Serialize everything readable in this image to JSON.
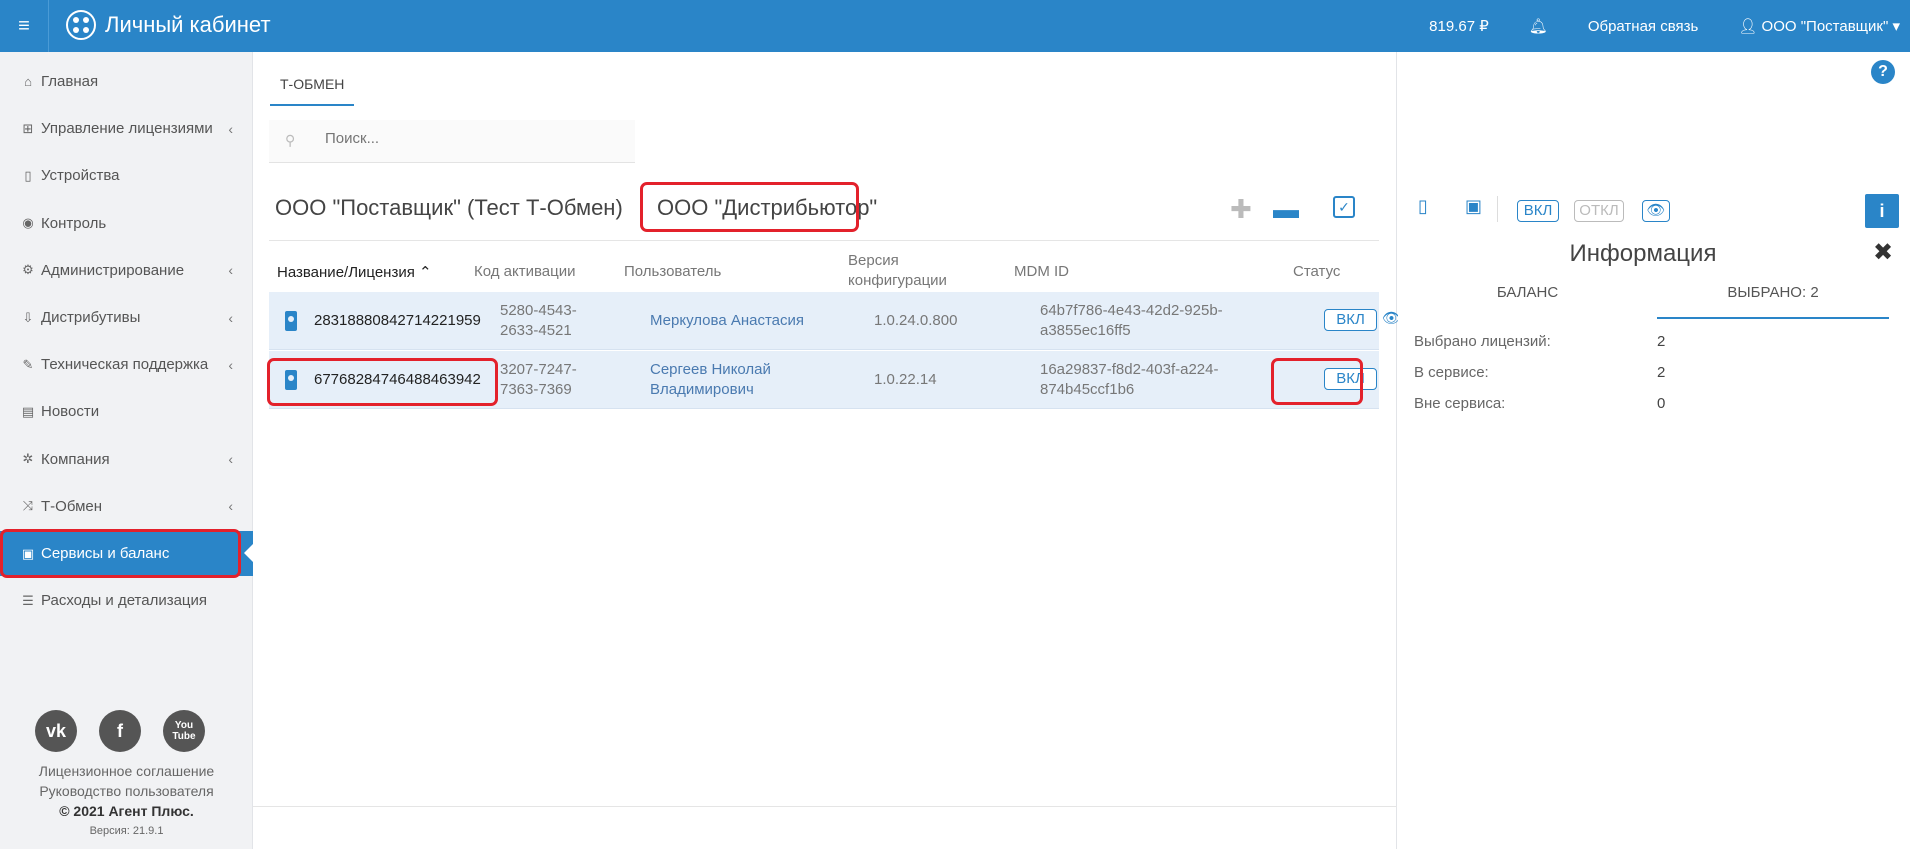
{
  "topbar": {
    "title": "Личный кабинет",
    "balance": "819.67 ₽",
    "feedback": "Обратная связь",
    "account": "ООО \"Поставщик\""
  },
  "sidebar": {
    "items": [
      {
        "label": "Главная",
        "icon": "home-icon",
        "glyph": "⌂",
        "chevron": false
      },
      {
        "label": "Управление лицензиями",
        "icon": "sitemap-icon",
        "glyph": "⊞",
        "chevron": true
      },
      {
        "label": "Устройства",
        "icon": "mobile-icon",
        "glyph": "▯",
        "chevron": false
      },
      {
        "label": "Контроль",
        "icon": "globe-icon",
        "glyph": "◉",
        "chevron": false
      },
      {
        "label": "Администрирование",
        "icon": "gears-icon",
        "glyph": "⚙",
        "chevron": true
      },
      {
        "label": "Дистрибутивы",
        "icon": "download-icon",
        "glyph": "⇩",
        "chevron": true
      },
      {
        "label": "Техническая поддержка",
        "icon": "wrench-icon",
        "glyph": "✎",
        "chevron": true
      },
      {
        "label": "Новости",
        "icon": "newspaper-icon",
        "glyph": "▤",
        "chevron": false
      },
      {
        "label": "Компания",
        "icon": "gear-icon",
        "glyph": "✲",
        "chevron": true
      },
      {
        "label": "Т-Обмен",
        "icon": "shuffle-icon",
        "glyph": "⤨",
        "chevron": true
      },
      {
        "label": "Сервисы и баланс",
        "icon": "money-icon",
        "glyph": "▣",
        "chevron": false,
        "active": true
      },
      {
        "label": "Расходы и детализация",
        "icon": "list-icon",
        "glyph": "☰",
        "chevron": false
      }
    ],
    "social": [
      {
        "name": "vk-icon",
        "glyph": "vk"
      },
      {
        "name": "facebook-icon",
        "glyph": "f"
      },
      {
        "name": "youtube-icon",
        "glyph": "You Tube"
      }
    ],
    "footer": {
      "license": "Лицензионное соглашение",
      "manual": "Руководство пользователя",
      "copyright": "© 2021 Агент Плюс.",
      "version": "Версия: 21.9.1"
    }
  },
  "main": {
    "tab": "Т-ОБМЕН",
    "search_placeholder": "Поиск...",
    "breadcrumb_parent": "ООО \"Поставщик\" (Тест Т-Обмен)",
    "breadcrumb_current": "ООО \"Дистрибьютор\"",
    "columns": [
      "Название/Лицензия ⌃",
      "Код активации",
      "Пользователь",
      "Версия конфигурации",
      "MDM ID",
      "Статус"
    ],
    "rows": [
      {
        "license": "28318880842714221959",
        "code": "5280-4543-2633-4521",
        "user": "Меркулова Анастасия",
        "version": "1.0.24.0.800",
        "mdm": "64b7f786-4e43-42d2-925b-a3855ec16ff5",
        "status": "ВКЛ"
      },
      {
        "license": "67768284746488463942",
        "code": "3207-7247-7363-7369",
        "user": "Сергеев Николай Владимирович",
        "version": "1.0.22.14",
        "mdm": "16a29837-f8d2-403f-a224-874b45ccf1b6",
        "status": "ВКЛ"
      }
    ]
  },
  "panel": {
    "chip_on": "ВКЛ",
    "chip_off": "ОТКЛ",
    "title": "Информация",
    "tab_balance": "БАЛАНС",
    "tab_selected": "ВЫБРАНО: 2",
    "stats": [
      {
        "label": "Выбрано лицензий:",
        "value": "2"
      },
      {
        "label": "В сервисе:",
        "value": "2"
      },
      {
        "label": "Вне сервиса:",
        "value": "0"
      }
    ]
  }
}
